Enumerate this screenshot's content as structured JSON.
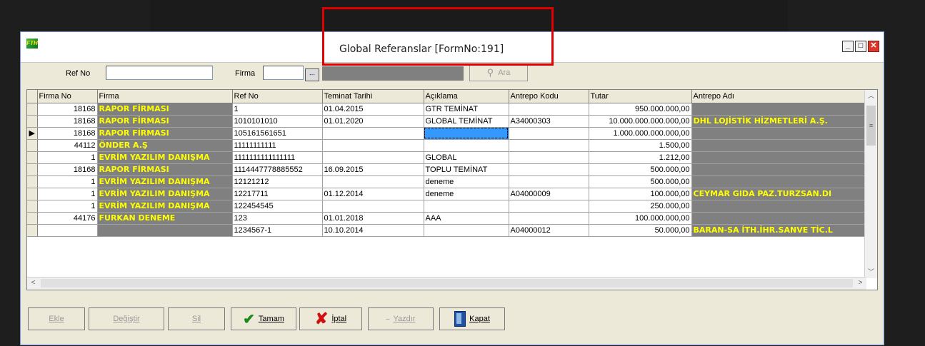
{
  "window": {
    "title": "Global Referanslar [FormNo:191]",
    "app_icon_text": "FTH"
  },
  "search": {
    "refno_label": "Ref No",
    "refno_value": "",
    "firma_label": "Firma",
    "firma_value": "",
    "ara_label": "Ara"
  },
  "grid": {
    "columns": [
      "Firma No",
      "Firma",
      "Ref No",
      "Teminat Tarihi",
      "Açıklama",
      "Antrepo Kodu",
      "Tutar",
      "Antrepo Adı"
    ],
    "rows": [
      [
        "18168",
        "RAPOR FİRMASI",
        "1",
        "01.04.2015",
        "GTR TEMİNAT",
        "",
        "950.000.000,00",
        ""
      ],
      [
        "18168",
        "RAPOR FİRMASI",
        "1010101010",
        "01.01.2020",
        "GLOBAL TEMİNAT",
        "A34000303",
        "10.000.000.000.000,00",
        "DHL LOJİSTİK HİZMETLERİ A.Ş."
      ],
      [
        "18168",
        "RAPOR FİRMASI",
        "105161561651",
        "",
        "",
        "",
        "1.000.000.000.000,00",
        ""
      ],
      [
        "44112",
        "ÖNDER A.Ş",
        "11111111111",
        "",
        "",
        "",
        "1.500,00",
        ""
      ],
      [
        "1",
        "EVRİM YAZILIM DANIŞMA",
        "1111111111111111",
        "",
        "GLOBAL",
        "",
        "1.212,00",
        ""
      ],
      [
        "18168",
        "RAPOR FİRMASI",
        "1114447778885552",
        "16.09.2015",
        "TOPLU TEMİNAT",
        "",
        "500.000,00",
        ""
      ],
      [
        "1",
        "EVRİM YAZILIM DANIŞMA",
        "12121212",
        "",
        "deneme",
        "",
        "500.000,00",
        ""
      ],
      [
        "1",
        "EVRİM YAZILIM DANIŞMA",
        "12217711",
        "01.12.2014",
        "deneme",
        "A04000009",
        "100.000,00",
        "CEYMAR GIDA PAZ.TURZSAN.DI"
      ],
      [
        "1",
        "EVRİM YAZILIM DANIŞMA",
        "122454545",
        "",
        "",
        "",
        "250.000,00",
        ""
      ],
      [
        "44176",
        "FURKAN DENEME",
        "123",
        "01.01.2018",
        "AAA",
        "",
        "100.000.000,00",
        ""
      ],
      [
        "",
        "",
        "1234567-1",
        "10.10.2014",
        "",
        "A04000012",
        "50.000,00",
        "BARAN-SA İTH.İHR.SANVE TİC.L"
      ]
    ],
    "current_row_marker": "▶",
    "current_row_index": 2
  },
  "buttons": {
    "ekle": "Ekle",
    "degistir": "Değiştir",
    "sil": "Sil",
    "tamam": "Tamam",
    "iptal": "İptal",
    "yazdir": "Yazdır",
    "kapat": "Kapat"
  },
  "colors": {
    "highlight_bg": "#808080",
    "highlight_fg": "#ffff00",
    "selection": "#3399ff",
    "annotation_red": "#e00000"
  }
}
